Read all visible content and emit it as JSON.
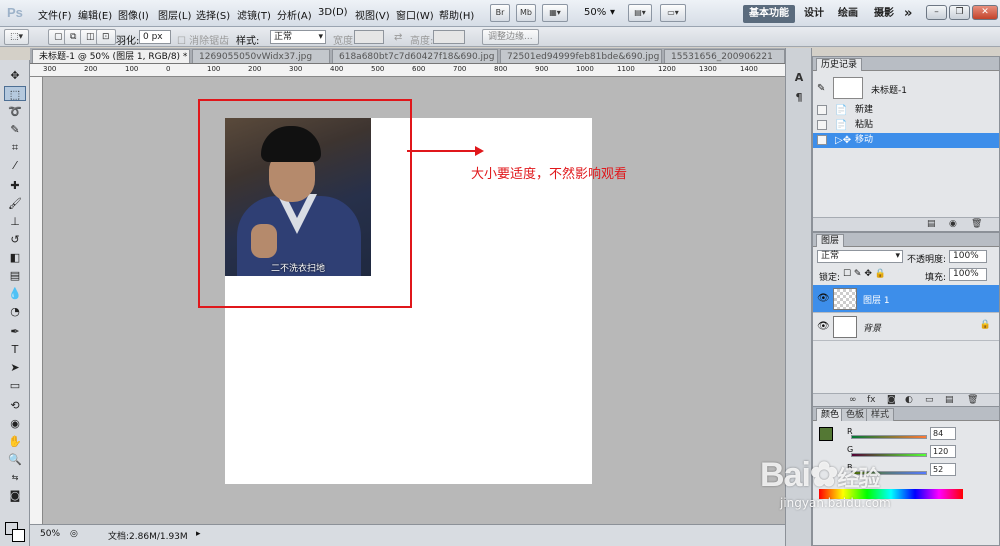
{
  "menubar": {
    "logo": "Ps",
    "items": [
      "文件(F)",
      "编辑(E)",
      "图像(I)",
      "图层(L)",
      "选择(S)",
      "滤镜(T)",
      "分析(A)",
      "3D(D)",
      "视图(V)",
      "窗口(W)",
      "帮助(H)"
    ],
    "bridge_label": "Br",
    "minibridge_label": "Mb",
    "zoom": "50%",
    "workspaces": [
      "基本功能",
      "设计",
      "绘画",
      "摄影"
    ],
    "more": "»"
  },
  "options": {
    "feather_label": "羽化:",
    "feather_value": "0 px",
    "antialias_label": "消除锯齿",
    "style_label": "样式:",
    "style_value": "正常",
    "width_label": "宽度:",
    "height_label": "高度:",
    "refine_edge": "调整边缘..."
  },
  "tabs": [
    "未标题-1 @ 50% (图层 1, RGB/8) *",
    "1269055050vWidx37.jpg",
    "618a680bt7c7d60427f18&690.jpg",
    "72501ed94999feb81bde&690.jpg",
    "15531656_200906221"
  ],
  "ruler": [
    "300",
    "200",
    "100",
    "0",
    "100",
    "200",
    "300",
    "400",
    "500",
    "600",
    "700",
    "800",
    "900",
    "1000",
    "1100",
    "1200",
    "1300",
    "1400"
  ],
  "canvas": {
    "photo_caption": "二不洗衣扫地",
    "annotation": "大小要适度，不然影响观看"
  },
  "status": {
    "zoom": "50%",
    "doc_info": "文档:2.86M/1.93M"
  },
  "history": {
    "tab": "历史记录",
    "snapshot": "未标题-1",
    "steps": [
      "新建",
      "粘贴",
      "移动"
    ]
  },
  "layers": {
    "tab": "图层",
    "blend_mode": "正常",
    "opacity_label": "不透明度:",
    "opacity_value": "100%",
    "lock_label": "锁定:",
    "fill_label": "填充:",
    "fill_value": "100%",
    "items": [
      {
        "name": "图层 1"
      },
      {
        "name": "背景"
      }
    ]
  },
  "color": {
    "tabs": [
      "颜色",
      "色板",
      "样式"
    ],
    "channels": [
      {
        "label": "R",
        "value": "84"
      },
      {
        "label": "G",
        "value": "120"
      },
      {
        "label": "B",
        "value": "52"
      }
    ],
    "foreground": "#547834",
    "accent": "#e0171b",
    "selection": "#3d8eea"
  },
  "watermark": {
    "brand": "Bai",
    "brand2": "经验",
    "url": "jingyan.baidu.com"
  }
}
